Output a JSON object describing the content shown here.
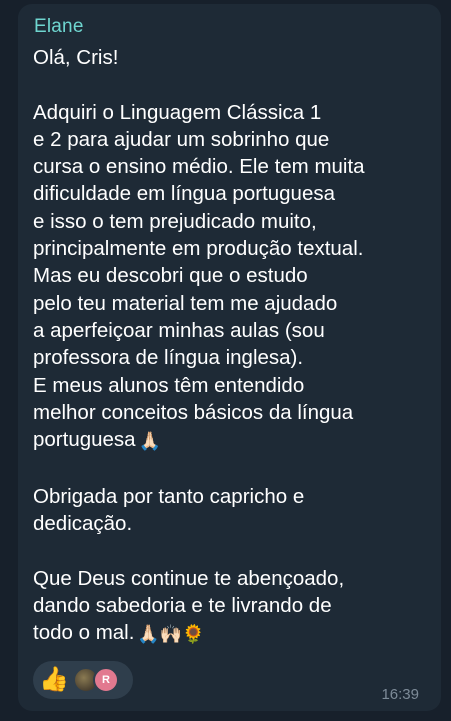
{
  "message": {
    "sender": "Elane",
    "paragraphs": [
      "Olá, Cris!",
      "Adquiri o Linguagem Clássica 1\ne 2 para ajudar um sobrinho que\ncursa o ensino médio. Ele tem muita\ndificuldade em língua portuguesa\ne isso o tem prejudicado muito,\nprincipalmente em produção textual.\nMas eu descobri que o estudo\npelo teu material tem me ajudado\na aperfeiçoar minhas aulas (sou\nprofessora de língua inglesa).\nE meus alunos têm entendido\nmelhor conceitos básicos da língua\nportuguesa",
      "Obrigada por tanto capricho e\ndedicação.",
      "Que Deus continue te abençoado,\ndando sabedoria e te livrando de\ntodo o mal."
    ],
    "emoji_after_portuguesa": "🙏🏻",
    "emoji_end": "🙏🏻🙌🏻🌻",
    "time": "16:39"
  },
  "reactions": {
    "emoji": "👍",
    "avatar_letter": "R"
  },
  "colors": {
    "background": "#17202b",
    "bubble": "#1e2a36",
    "sender_name": "#6fd6d0",
    "text": "#ffffff",
    "timestamp": "#7d8b98",
    "reaction_pill": "#2f3e4c",
    "avatar_r": "#e2798f"
  }
}
